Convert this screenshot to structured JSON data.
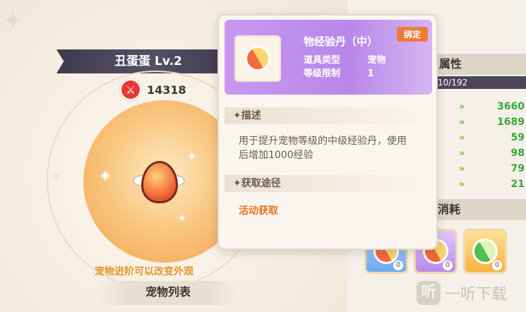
{
  "pet": {
    "name_level": "丑蛋蛋 Lv.2",
    "power": "14318",
    "evolve_hint": "宠物进阶可以改变外观",
    "list_button": "宠物列表"
  },
  "attributes": {
    "header": "属性",
    "exp_text": "10/192",
    "values": [
      "3660",
      "1689",
      "59",
      "98",
      "79",
      "21"
    ]
  },
  "consume": {
    "header": "消耗",
    "items": [
      {
        "rarity": "blue",
        "count": "0"
      },
      {
        "rarity": "purple",
        "count": "0"
      },
      {
        "rarity": "gold",
        "count": "0"
      }
    ]
  },
  "tooltip": {
    "item_name": "物经验丹（中）",
    "badge": "绑定",
    "type_label": "道具类型",
    "type_value": "宠物",
    "level_label": "等级限制",
    "level_value": "1",
    "desc_title": "✦描述",
    "description": "用于提升宠物等级的中级经验丹，使用后增加1000经验",
    "source_title": "✦获取途径",
    "source": "活动获取"
  },
  "watermark": {
    "logo": "听",
    "text": "一听下载"
  },
  "colors": {
    "tooltip_header": "#c898f0",
    "attr_value": "#3aa63a",
    "source_link": "#e8731f",
    "evolve_hint": "#e3962b"
  }
}
